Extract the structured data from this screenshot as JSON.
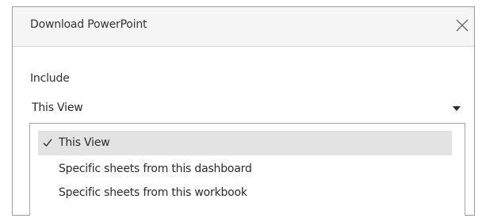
{
  "dialog": {
    "title": "Download PowerPoint",
    "close_icon": "close-icon"
  },
  "include": {
    "label": "Include",
    "selected_value": "This View",
    "dropdown_icon": "chevron-down-icon",
    "options": [
      {
        "label": "This View",
        "checked": true
      },
      {
        "label": "Specific sheets from this dashboard",
        "checked": false
      },
      {
        "label": "Specific sheets from this workbook",
        "checked": false
      }
    ]
  },
  "colors": {
    "title_bar_bg": "#f5f5f5",
    "selected_option_bg": "#e3e3e3",
    "border": "#9a9a9a",
    "text": "#2b2b2b"
  }
}
